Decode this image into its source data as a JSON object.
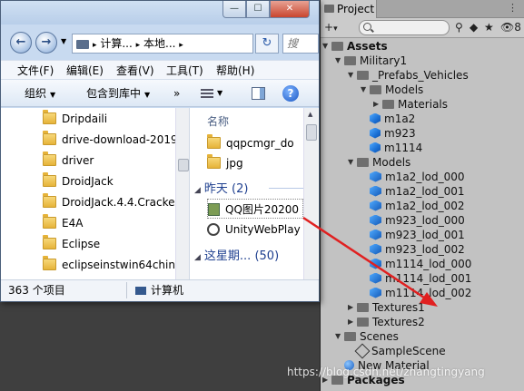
{
  "explorer": {
    "title_buttons": {
      "minimize": "—",
      "maximize": "☐",
      "close": "✕"
    },
    "nav": {
      "back": "←",
      "forward": "→"
    },
    "address": {
      "segment1": "计算...",
      "sep": "▸",
      "segment2": "本地...",
      "more": "▸"
    },
    "refresh": "↻",
    "search_placeholder": "搜",
    "menu": [
      "文件(F)",
      "编辑(E)",
      "查看(V)",
      "工具(T)",
      "帮助(H)"
    ],
    "toolbar": {
      "organize": "组织",
      "include_library": "包含到库中",
      "more": "»",
      "help": "?"
    },
    "folders": [
      "Dripdaili",
      "drive-download-2019",
      "driver",
      "DroidJack",
      "DroidJack.4.4.Cracke",
      "E4A",
      "Eclipse",
      "eclipseinstwin64chine"
    ],
    "file_pane": {
      "column_name": "名称",
      "items_top": [
        "qqpcmgr_do",
        "jpg"
      ],
      "group1": "昨天 (2)",
      "group1_items": [
        "QQ图片20200",
        "UnityWebPlay"
      ],
      "group2": "这星期... (50)"
    },
    "status": {
      "count": "363 个项目",
      "location": "计算机"
    }
  },
  "unity": {
    "tab_title": "Project",
    "tab_menu": "⋮",
    "toolbar": {
      "add": "+",
      "add_dd": "▾",
      "lock_hidden_count": "8"
    },
    "tree": [
      {
        "label": "Assets",
        "depth": 0,
        "expanded": true,
        "kind": "folder",
        "bold": true
      },
      {
        "label": "Military1",
        "depth": 1,
        "expanded": true,
        "kind": "folder"
      },
      {
        "label": "_Prefabs_Vehicles",
        "depth": 2,
        "expanded": true,
        "kind": "folder"
      },
      {
        "label": "Models",
        "depth": 3,
        "expanded": true,
        "kind": "folder"
      },
      {
        "label": "Materials",
        "depth": 4,
        "expanded": false,
        "kind": "folder"
      },
      {
        "label": "m1a2",
        "depth": 3,
        "kind": "prefab"
      },
      {
        "label": "m923",
        "depth": 3,
        "kind": "prefab"
      },
      {
        "label": "m1114",
        "depth": 3,
        "kind": "prefab"
      },
      {
        "label": "Models",
        "depth": 2,
        "expanded": true,
        "kind": "folder"
      },
      {
        "label": "m1a2_lod_000",
        "depth": 3,
        "kind": "model"
      },
      {
        "label": "m1a2_lod_001",
        "depth": 3,
        "kind": "model"
      },
      {
        "label": "m1a2_lod_002",
        "depth": 3,
        "kind": "model"
      },
      {
        "label": "m923_lod_000",
        "depth": 3,
        "kind": "model"
      },
      {
        "label": "m923_lod_001",
        "depth": 3,
        "kind": "model"
      },
      {
        "label": "m923_lod_002",
        "depth": 3,
        "kind": "model"
      },
      {
        "label": "m1114_lod_000",
        "depth": 3,
        "kind": "model"
      },
      {
        "label": "m1114_lod_001",
        "depth": 3,
        "kind": "model"
      },
      {
        "label": "m1114_lod_002",
        "depth": 3,
        "kind": "model"
      },
      {
        "label": "Textures1",
        "depth": 2,
        "expanded": false,
        "kind": "folder"
      },
      {
        "label": "Textures2",
        "depth": 2,
        "expanded": false,
        "kind": "folder"
      },
      {
        "label": "Scenes",
        "depth": 1,
        "expanded": true,
        "kind": "folder"
      },
      {
        "label": "SampleScene",
        "depth": 2,
        "kind": "scene"
      },
      {
        "label": "New Material",
        "depth": 1,
        "kind": "material"
      },
      {
        "label": "Packages",
        "depth": 0,
        "expanded": false,
        "kind": "folder",
        "bold": true
      }
    ]
  },
  "watermark": "https://blog.csdn.net/zhangtingyang",
  "colors": {
    "arrow": "#e02020",
    "unity_panel": "#c2c2c2",
    "explorer_frame": "#c8daf0"
  }
}
